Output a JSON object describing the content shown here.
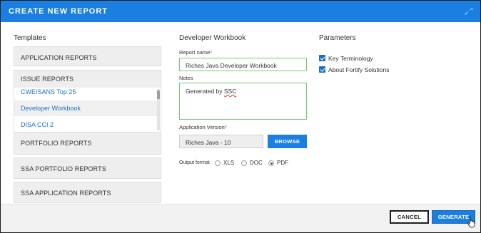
{
  "dialog": {
    "title": "CREATE NEW REPORT"
  },
  "templates": {
    "heading": "Templates",
    "groups": [
      {
        "label": "APPLICATION REPORTS"
      },
      {
        "label": "ISSUE REPORTS"
      },
      {
        "label": "PORTFOLIO REPORTS"
      },
      {
        "label": "SSA PORTFOLIO REPORTS"
      },
      {
        "label": "SSA APPLICATION REPORTS"
      }
    ],
    "issue_items": [
      {
        "label": "CWE/SANS Top 25"
      },
      {
        "label": "Developer Workbook"
      },
      {
        "label": "DISA CCI 2"
      }
    ],
    "selected_item": "Developer Workbook"
  },
  "form": {
    "heading": "Developer Workbook",
    "report_name_label": "Report name",
    "report_name_value": "Riches Java Developer Workbook",
    "notes_label": "Notes",
    "notes_value_prefix": "Generated by ",
    "notes_value_misspelled": "SSC",
    "app_version_label": "Application Version",
    "app_version_value": "Riches Java - 10",
    "browse_label": "BROWSE",
    "output_format_label": "Output format",
    "output_formats": [
      {
        "label": "XLS",
        "selected": false
      },
      {
        "label": "DOC",
        "selected": false
      },
      {
        "label": "PDF",
        "selected": true
      }
    ],
    "required_marker": "*"
  },
  "parameters": {
    "heading": "Parameters",
    "items": [
      {
        "label": "Key Terminology",
        "checked": true
      },
      {
        "label": "About Fortify Solutions",
        "checked": true
      }
    ]
  },
  "footer": {
    "cancel_label": "CANCEL",
    "generate_label": "GENERATE"
  },
  "colors": {
    "accent": "#1a7fe0",
    "link": "#1a73c9",
    "valid_border": "#6fcf6f",
    "required": "#e53935"
  }
}
